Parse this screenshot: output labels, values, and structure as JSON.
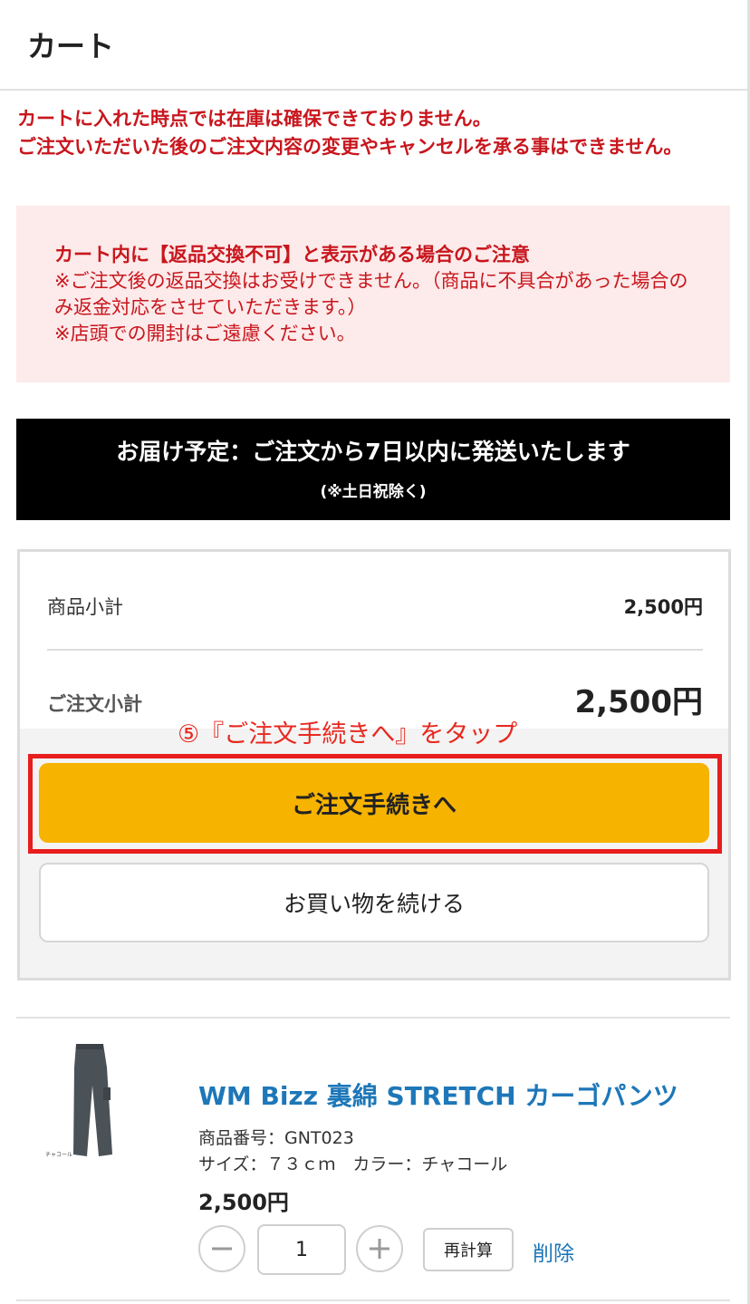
{
  "header": {
    "title": "カート"
  },
  "warning": {
    "line1": "カートに入れた時点では在庫は確保できておりません。",
    "line2": "ご注文いただいた後のご注文内容の変更やキャンセルを承る事はできません。"
  },
  "notice": {
    "title": "カート内に【返品交換不可】と表示がある場合のご注意",
    "line1": "※ご注文後の返品交換はお受けできません。（商品に不具合があった場合のみ返金対応をさせていただきます。）",
    "line2": "※店頭での開封はご遠慮ください。"
  },
  "delivery": {
    "main": "お届け予定：ご注文から7日以内に発送いたします",
    "sub": "(※土日祝除く)"
  },
  "summary": {
    "subtotal_label": "商品小計",
    "subtotal_value": "2,500円",
    "order_label": "ご注文小計",
    "order_value": "2,500円"
  },
  "annotation": "⑤『ご注文手続きへ』をタップ",
  "buttons": {
    "checkout": "ご注文手続きへ",
    "continue": "お買い物を続ける"
  },
  "product": {
    "name": "WM Bizz 裏綿 STRETCH カーゴパンツ",
    "code": "商品番号：GNT023",
    "size_color": "サイズ：７３ｃｍ　カラー：チャコール",
    "price": "2,500円",
    "quantity": "1",
    "recalc": "再計算",
    "delete": "削除",
    "thumb_label": "チャコール"
  },
  "colors": {
    "accent_red": "#c8161d",
    "checkout_yellow": "#f6b300",
    "link_blue": "#1d77b8",
    "highlight_red": "#e81d1d"
  }
}
